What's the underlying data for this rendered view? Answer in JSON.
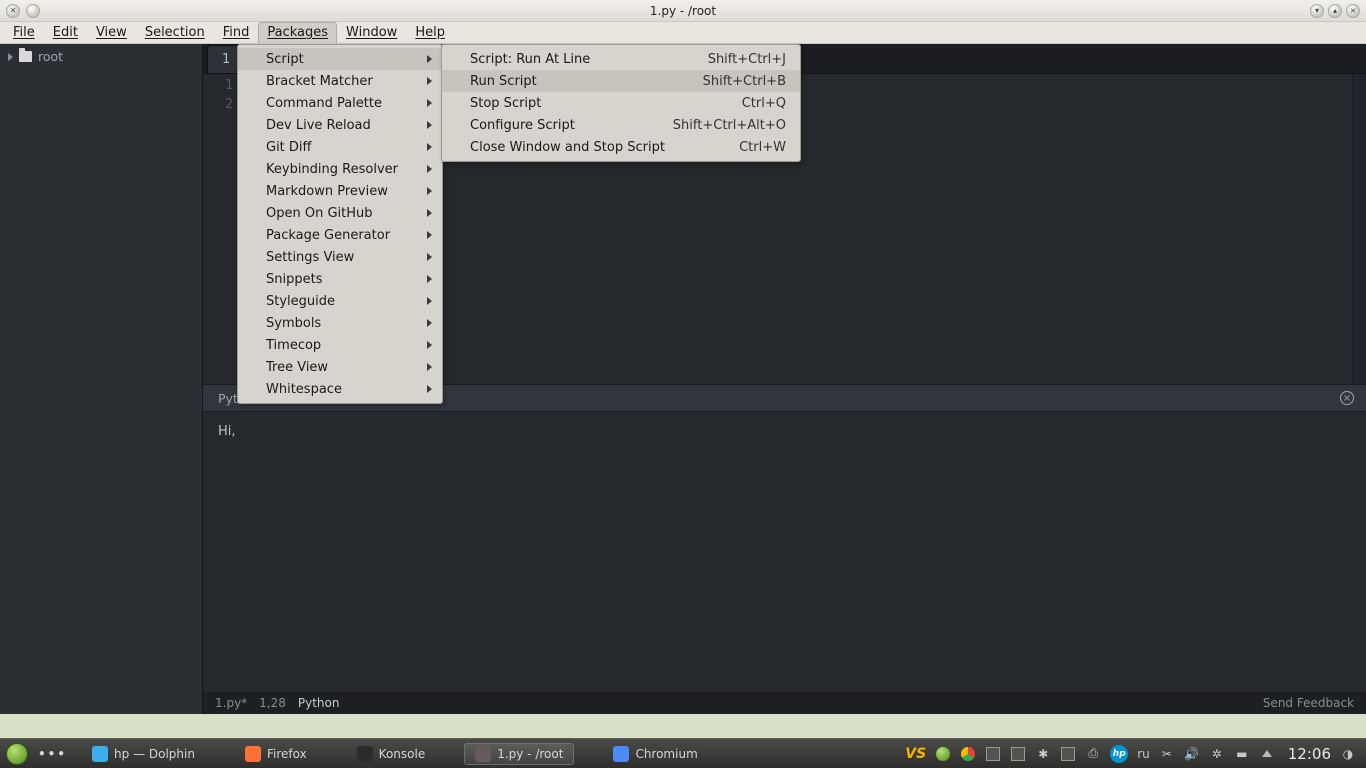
{
  "window": {
    "title": "1.py - /root"
  },
  "menubar": [
    "File",
    "Edit",
    "View",
    "Selection",
    "Find",
    "Packages",
    "Window",
    "Help"
  ],
  "sidebar": {
    "root_label": "root"
  },
  "tab": {
    "label": "1"
  },
  "gutter": [
    "1",
    "2"
  ],
  "status_strip": {
    "label_prefix": "Pyth"
  },
  "console": {
    "line1": "Hi,"
  },
  "bottom_status": {
    "file": "1.py*",
    "pos": "1,28",
    "lang": "Python",
    "feedback": "Send Feedback"
  },
  "packages_menu": {
    "items": [
      {
        "label": "Script",
        "sub": true,
        "hover": true
      },
      {
        "label": "Bracket Matcher",
        "sub": true
      },
      {
        "label": "Command Palette",
        "sub": true
      },
      {
        "label": "Dev Live Reload",
        "sub": true
      },
      {
        "label": "Git Diff",
        "sub": true
      },
      {
        "label": "Keybinding Resolver",
        "sub": true
      },
      {
        "label": "Markdown Preview",
        "sub": true
      },
      {
        "label": "Open On GitHub",
        "sub": true
      },
      {
        "label": "Package Generator",
        "sub": true
      },
      {
        "label": "Settings View",
        "sub": true
      },
      {
        "label": "Snippets",
        "sub": true
      },
      {
        "label": "Styleguide",
        "sub": true
      },
      {
        "label": "Symbols",
        "sub": true
      },
      {
        "label": "Timecop",
        "sub": true
      },
      {
        "label": "Tree View",
        "sub": true
      },
      {
        "label": "Whitespace",
        "sub": true
      }
    ]
  },
  "script_menu": {
    "items": [
      {
        "label": "Script: Run At Line",
        "shortcut": "Shift+Ctrl+J"
      },
      {
        "label": "Run Script",
        "shortcut": "Shift+Ctrl+B",
        "hover": true
      },
      {
        "label": "Stop Script",
        "shortcut": "Ctrl+Q"
      },
      {
        "label": "Configure Script",
        "shortcut": "Shift+Ctrl+Alt+O"
      },
      {
        "label": "Close Window and Stop Script",
        "shortcut": "Ctrl+W"
      }
    ]
  },
  "taskbar": {
    "apps": [
      {
        "label": "hp — Dolphin",
        "icon": "dolphin"
      },
      {
        "label": "Firefox",
        "icon": "firefox"
      },
      {
        "label": "Konsole",
        "icon": "konsole"
      },
      {
        "label": "1.py - /root",
        "icon": "atom",
        "active": true
      },
      {
        "label": "Chromium",
        "icon": "chromium"
      }
    ],
    "lang": "ru",
    "clock": "12:06"
  }
}
